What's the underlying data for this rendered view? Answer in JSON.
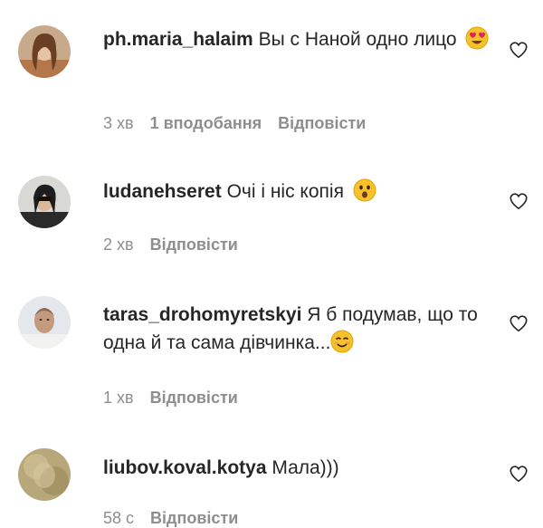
{
  "comments": [
    {
      "username": "ph.maria_halaim",
      "text": "Вы с Наной одно лицо",
      "emoji": "heart-eyes-emoji",
      "time": "3 хв",
      "likes": "1 вподобання",
      "reply": "Відповісти"
    },
    {
      "username": "ludanehseret",
      "text": "Очі і ніс копія",
      "emoji": "astonished-emoji",
      "time": "2 хв",
      "reply": "Відповісти"
    },
    {
      "username": "taras_drohomyretskyi",
      "text": "Я б подумав, що то одна й та сама дівчинка...",
      "emoji": "smiling-emoji",
      "time": "1 хв",
      "reply": "Відповісти"
    },
    {
      "username": "liubov.koval.kotya",
      "text": "Мала)))",
      "time": "58 с",
      "reply": "Відповісти"
    }
  ],
  "colors": {
    "primary_text": "#262626",
    "secondary_text": "#8e8e8e",
    "emoji_yellow": "#f7c12b"
  }
}
